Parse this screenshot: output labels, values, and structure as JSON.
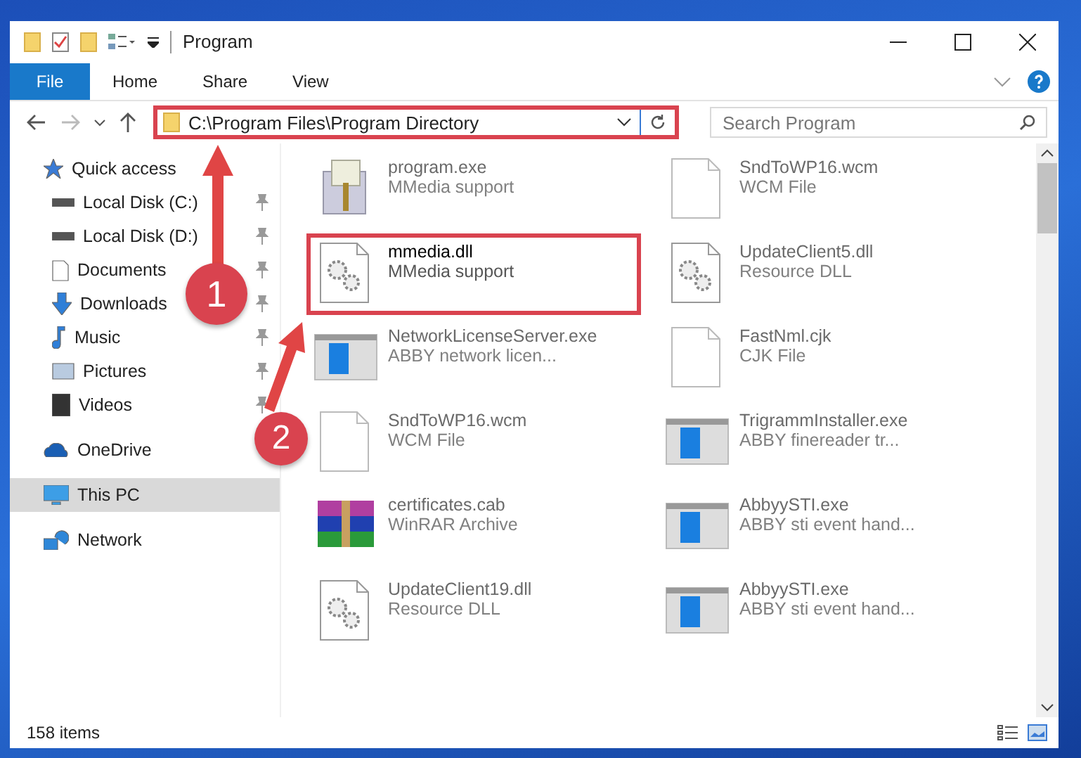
{
  "window": {
    "title": "Program"
  },
  "ribbon_tabs": [
    {
      "label": "File",
      "selected": true
    },
    {
      "label": "Home",
      "selected": false
    },
    {
      "label": "Share",
      "selected": false
    },
    {
      "label": "View",
      "selected": false
    }
  ],
  "address_bar": {
    "path": "C:\\Program Files\\Program Directory",
    "highlighted": true
  },
  "search": {
    "placeholder": "Search Program"
  },
  "sidebar": {
    "items": [
      {
        "label": "Quick access",
        "kind": "star",
        "selected": false,
        "children": [
          {
            "label": "Local Disk (C:)",
            "kind": "disk",
            "pinned": true,
            "selected": false
          },
          {
            "label": "Local Disk (D:)",
            "kind": "disk",
            "pinned": true,
            "selected": false
          },
          {
            "label": "Documents",
            "kind": "doc",
            "pinned": true,
            "selected": false
          },
          {
            "label": "Downloads",
            "kind": "download",
            "pinned": true,
            "selected": false
          },
          {
            "label": "Music",
            "kind": "music",
            "pinned": true,
            "selected": false
          },
          {
            "label": "Pictures",
            "kind": "pictures",
            "pinned": true,
            "selected": false
          },
          {
            "label": "Videos",
            "kind": "videos",
            "pinned": true,
            "selected": false
          }
        ]
      },
      {
        "label": "OneDrive",
        "kind": "cloud",
        "selected": false
      },
      {
        "label": "This PC",
        "kind": "pc",
        "selected": true
      },
      {
        "label": "Network",
        "kind": "network",
        "selected": false
      }
    ]
  },
  "files": [
    {
      "name": "program.exe",
      "type": "MMedia support",
      "kind": "installer",
      "dimmed": true,
      "highlighted": false
    },
    {
      "name": "SndToWP16.wcm",
      "type": "WCM File",
      "kind": "blank",
      "dimmed": true,
      "highlighted": false
    },
    {
      "name": "mmedia.dll",
      "type": "MMedia support",
      "kind": "gear",
      "dimmed": false,
      "highlighted": true
    },
    {
      "name": "UpdateClient5.dll",
      "type": "Resource DLL",
      "kind": "gear",
      "dimmed": true,
      "highlighted": false
    },
    {
      "name": "NetworkLicenseServer.exe",
      "type": "ABBY network licen...",
      "kind": "app",
      "dimmed": true,
      "highlighted": false
    },
    {
      "name": "FastNml.cjk",
      "type": "CJK File",
      "kind": "blank",
      "dimmed": true,
      "highlighted": false
    },
    {
      "name": "SndToWP16.wcm",
      "type": "WCM File",
      "kind": "blank",
      "dimmed": true,
      "highlighted": false
    },
    {
      "name": "TrigrammInstaller.exe",
      "type": "ABBY finereader tr...",
      "kind": "app",
      "dimmed": true,
      "highlighted": false
    },
    {
      "name": "certificates.cab",
      "type": "WinRAR Archive",
      "kind": "archive",
      "dimmed": true,
      "highlighted": false
    },
    {
      "name": "AbbyySTI.exe",
      "type": "ABBY sti event hand...",
      "kind": "app",
      "dimmed": true,
      "highlighted": false
    },
    {
      "name": "UpdateClient19.dll",
      "type": "Resource DLL",
      "kind": "gear",
      "dimmed": true,
      "highlighted": false
    },
    {
      "name": "AbbyySTI.exe",
      "type": "ABBY sti event hand...",
      "kind": "app",
      "dimmed": true,
      "highlighted": false
    }
  ],
  "status_bar": {
    "count": "158 items"
  },
  "annotations": [
    {
      "label": "1"
    },
    {
      "label": "2"
    }
  ]
}
